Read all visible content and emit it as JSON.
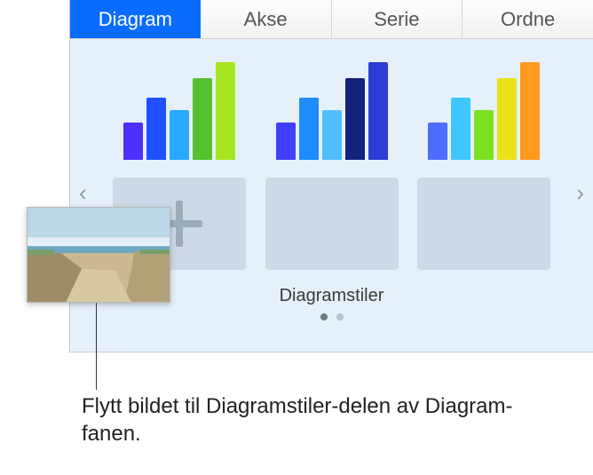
{
  "tabs": {
    "diagram": "Diagram",
    "akse": "Akse",
    "serie": "Serie",
    "ordne": "Ordne"
  },
  "styles_label": "Diagramstiler",
  "callout": "Flytt bildet til Diagramstiler-delen av Diagram-fanen.",
  "chart_styles": [
    {
      "colors": [
        "#4f2fff",
        "#1f4fff",
        "#2aa8ff",
        "#56c12e",
        "#a6e51f"
      ]
    },
    {
      "colors": [
        "#3f3fff",
        "#1f8bff",
        "#4fbfff",
        "#12227a",
        "#2d3cd6"
      ]
    },
    {
      "colors": [
        "#4c6dff",
        "#3ec7ff",
        "#7de01f",
        "#e8e21a",
        "#ff9a1f"
      ]
    }
  ],
  "bar_heights": [
    42,
    70,
    56,
    92,
    110
  ]
}
